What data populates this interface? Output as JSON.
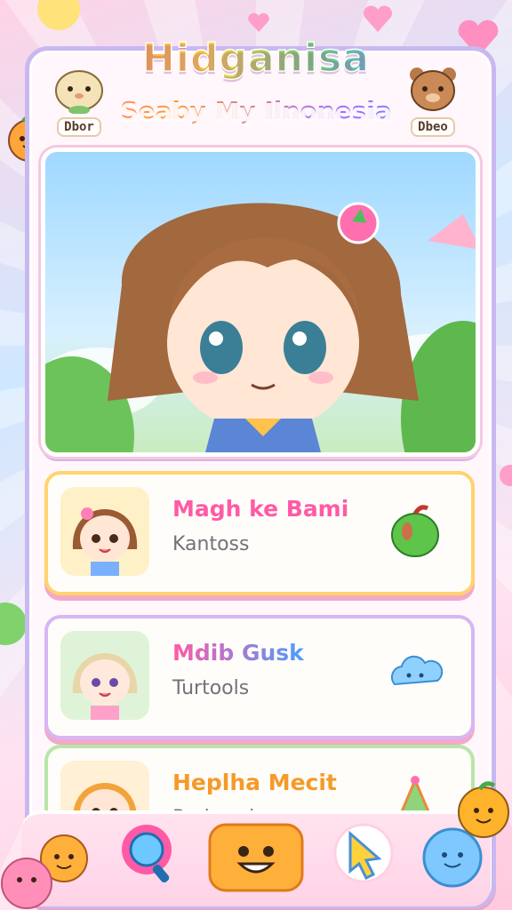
{
  "header": {
    "title": "Hidganisa",
    "subtitle": "Seaby My Ilnonesia",
    "left_pet_label": "Dbor",
    "right_pet_label": "Dbeo"
  },
  "cards": [
    {
      "name": "Magh ke Bami",
      "subtitle": "Kantoss",
      "icon": "apple-icon",
      "name_color": "#ff5aa5",
      "border": "#ffd36e"
    },
    {
      "name": "Mdib Gusk",
      "subtitle": "Turtools",
      "icon": "cloud-icon",
      "name_color": "#ff5aa5",
      "border": "#d7b6f5"
    },
    {
      "name": "Heplha Mecit",
      "subtitle": "Rodrued",
      "icon": "party-hat-icon",
      "name_color": "#f59a2a",
      "border": "#b8e6a8"
    }
  ],
  "nav": {
    "items": [
      "search-icon",
      "smile-icon",
      "cursor-icon",
      "cloud-face-icon"
    ]
  },
  "colors": {
    "accent": "#ff5aa5",
    "frame": "#c9b8f0",
    "active_button": "#ffb03b"
  }
}
